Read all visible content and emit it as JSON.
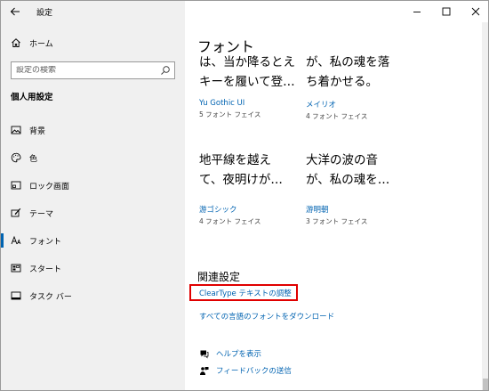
{
  "app": {
    "title": "設定"
  },
  "sidebar": {
    "home_label": "ホーム",
    "search_placeholder": "設定の検索",
    "section_title": "個人用設定",
    "items": [
      {
        "label": "背景",
        "icon": "image-icon"
      },
      {
        "label": "色",
        "icon": "palette-icon"
      },
      {
        "label": "ロック画面",
        "icon": "lock-screen-icon"
      },
      {
        "label": "テーマ",
        "icon": "theme-brush-icon"
      },
      {
        "label": "フォント",
        "icon": "font-icon",
        "active": true
      },
      {
        "label": "スタート",
        "icon": "start-grid-icon"
      },
      {
        "label": "タスク バー",
        "icon": "taskbar-icon"
      }
    ]
  },
  "main": {
    "title": "フォント",
    "fonts": [
      {
        "sample_line1": "は、当か降るとえ",
        "sample_line2": "キーを履いて登…",
        "name": "Yu Gothic UI",
        "count": "5 フォント フェイス"
      },
      {
        "sample_line1": "が、私の魂を落",
        "sample_line2": "ち着かせる。",
        "name": "メイリオ",
        "count": "4 フォント フェイス"
      },
      {
        "sample_line1": "地平線を越え",
        "sample_line2": "て、夜明けが…",
        "name": "游ゴシック",
        "count": "4 フォント フェイス"
      },
      {
        "sample_line1": "大洋の波の音",
        "sample_line2": "が、私の魂を…",
        "name": "游明朝",
        "count": "3 フォント フェイス"
      }
    ],
    "related": {
      "title": "関連設定",
      "links": [
        "ClearType テキストの調整",
        "すべての言語のフォントをダウンロード"
      ]
    },
    "help": {
      "show_help": "ヘルプを表示",
      "feedback": "フィードバックの送信"
    }
  },
  "colors": {
    "accent": "#0063b1",
    "highlight": "#e00000",
    "sidebar_bg": "#f0f0f0"
  }
}
